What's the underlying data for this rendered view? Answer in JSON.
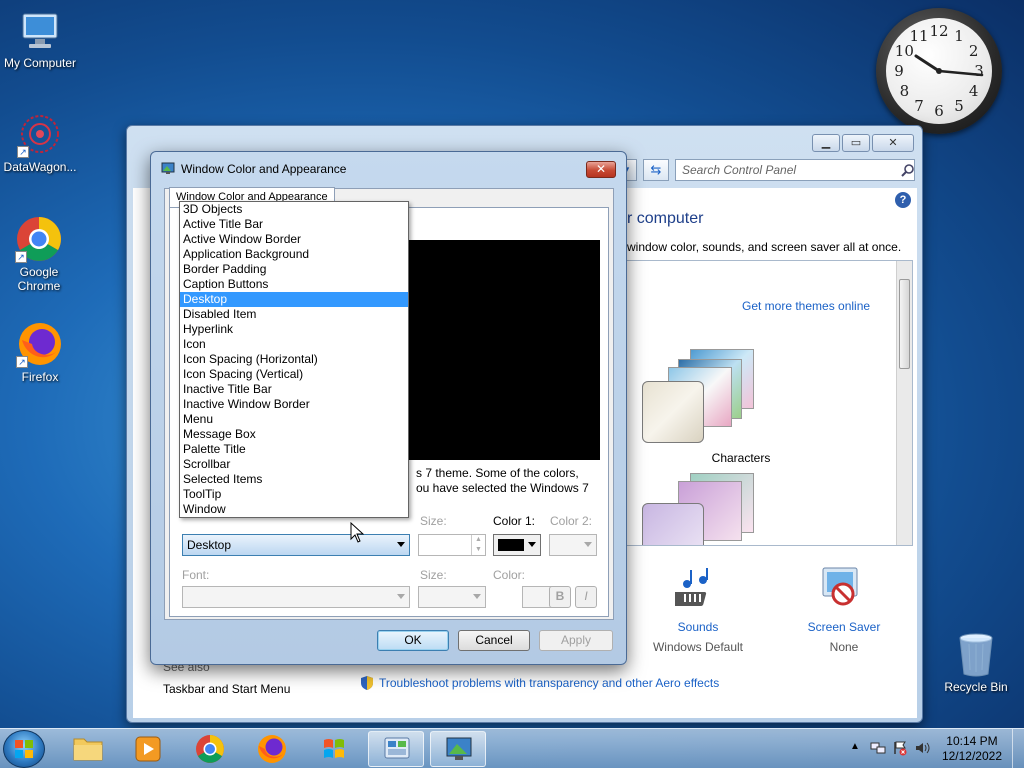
{
  "desktop": {
    "icons": [
      {
        "label": "My Computer"
      },
      {
        "label": "DataWagon..."
      },
      {
        "label": "Google Chrome"
      },
      {
        "label": "Firefox"
      },
      {
        "label": "Recycle Bin"
      }
    ],
    "clock_numbers": [
      "12",
      "1",
      "2",
      "3",
      "4",
      "5",
      "6",
      "7",
      "8",
      "9",
      "10",
      "11"
    ]
  },
  "control_panel": {
    "search_placeholder": "Search Control Panel",
    "heading_fragment": "r computer",
    "subtext_fragment": "window color, sounds, and screen saver all at once.",
    "get_more_themes": "Get more themes online",
    "theme_name": "Characters",
    "sounds_label": "Sounds",
    "sounds_value": "Windows Default",
    "screensaver_label": "Screen Saver",
    "screensaver_value": "None",
    "see_also": "See also",
    "taskbar_link": "Taskbar and Start Menu",
    "troubleshoot_link": "Troubleshoot problems with transparency and other Aero effects"
  },
  "dialog": {
    "title": "Window Color and Appearance",
    "tab_label": "Window Color and Appearance",
    "info_line1": "s 7 theme.  Some of the colors,",
    "info_line2": "ou have selected the Windows 7",
    "item_selected": "Desktop",
    "size_label": "Size:",
    "color1_label": "Color 1:",
    "color2_label": "Color 2:",
    "font_label": "Font:",
    "font_size_label": "Size:",
    "font_color_label": "Color:",
    "bold_label": "B",
    "italic_label": "I",
    "ok_label": "OK",
    "cancel_label": "Cancel",
    "apply_label": "Apply",
    "color1_value": "#000000",
    "preview_min": "_",
    "preview_max": "□",
    "preview_close": "✕"
  },
  "dropdown_items": [
    "3D Objects",
    "Active Title Bar",
    "Active Window Border",
    "Application Background",
    "Border Padding",
    "Caption Buttons",
    "Desktop",
    "Disabled Item",
    "Hyperlink",
    "Icon",
    "Icon Spacing (Horizontal)",
    "Icon Spacing (Vertical)",
    "Inactive Title Bar",
    "Inactive Window Border",
    "Menu",
    "Message Box",
    "Palette Title",
    "Scrollbar",
    "Selected Items",
    "ToolTip",
    "Window"
  ],
  "dropdown_selected": "Desktop",
  "taskbar": {
    "time": "10:14 PM",
    "date": "12/12/2022"
  }
}
